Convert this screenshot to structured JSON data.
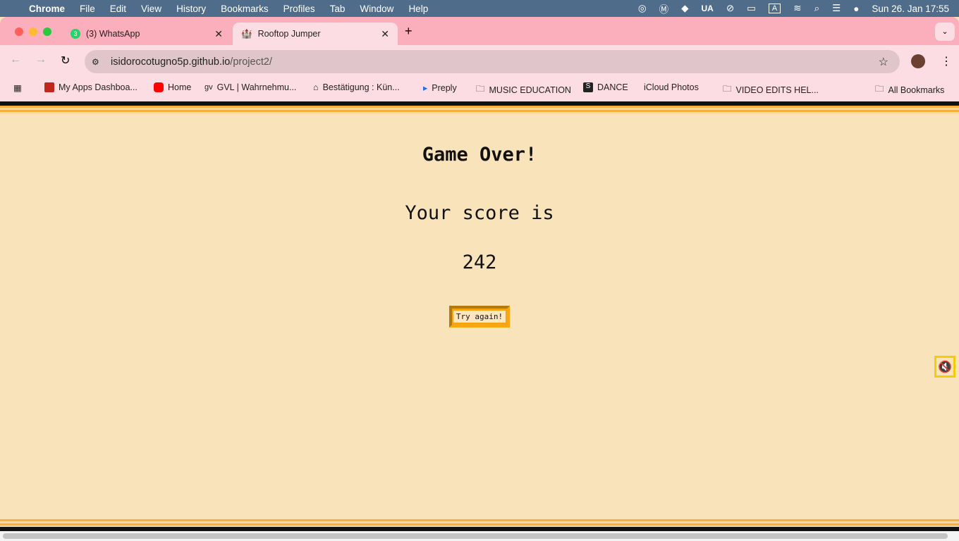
{
  "menubar": {
    "app": "Chrome",
    "items": [
      "File",
      "Edit",
      "View",
      "History",
      "Bookmarks",
      "Profiles",
      "Tab",
      "Window",
      "Help"
    ],
    "input_source": "UA",
    "datetime": "Sun 26. Jan  17:55"
  },
  "tabs": [
    {
      "label": "(3) WhatsApp",
      "badge": "3"
    },
    {
      "label": "Rooftop Jumper"
    }
  ],
  "address": {
    "host": "isidorocotugno5p.github.io",
    "path": "/project2/"
  },
  "bookmarks": [
    "My Apps Dashboa...",
    "Home",
    "GVL | Wahrnehmu...",
    "Bestätigung : Kün...",
    "Preply",
    "MUSIC EDUCATION",
    "DANCE",
    "iCloud Photos",
    "VIDEO EDITS HEL..."
  ],
  "all_bookmarks": "All Bookmarks",
  "game": {
    "title": "Game Over!",
    "score_label": "Your score is",
    "score": "242",
    "button": "Try again!"
  },
  "colors": {
    "background": "#f9e3bb",
    "accent": "#f4a40e",
    "tab_strip": "#fbaebb"
  }
}
